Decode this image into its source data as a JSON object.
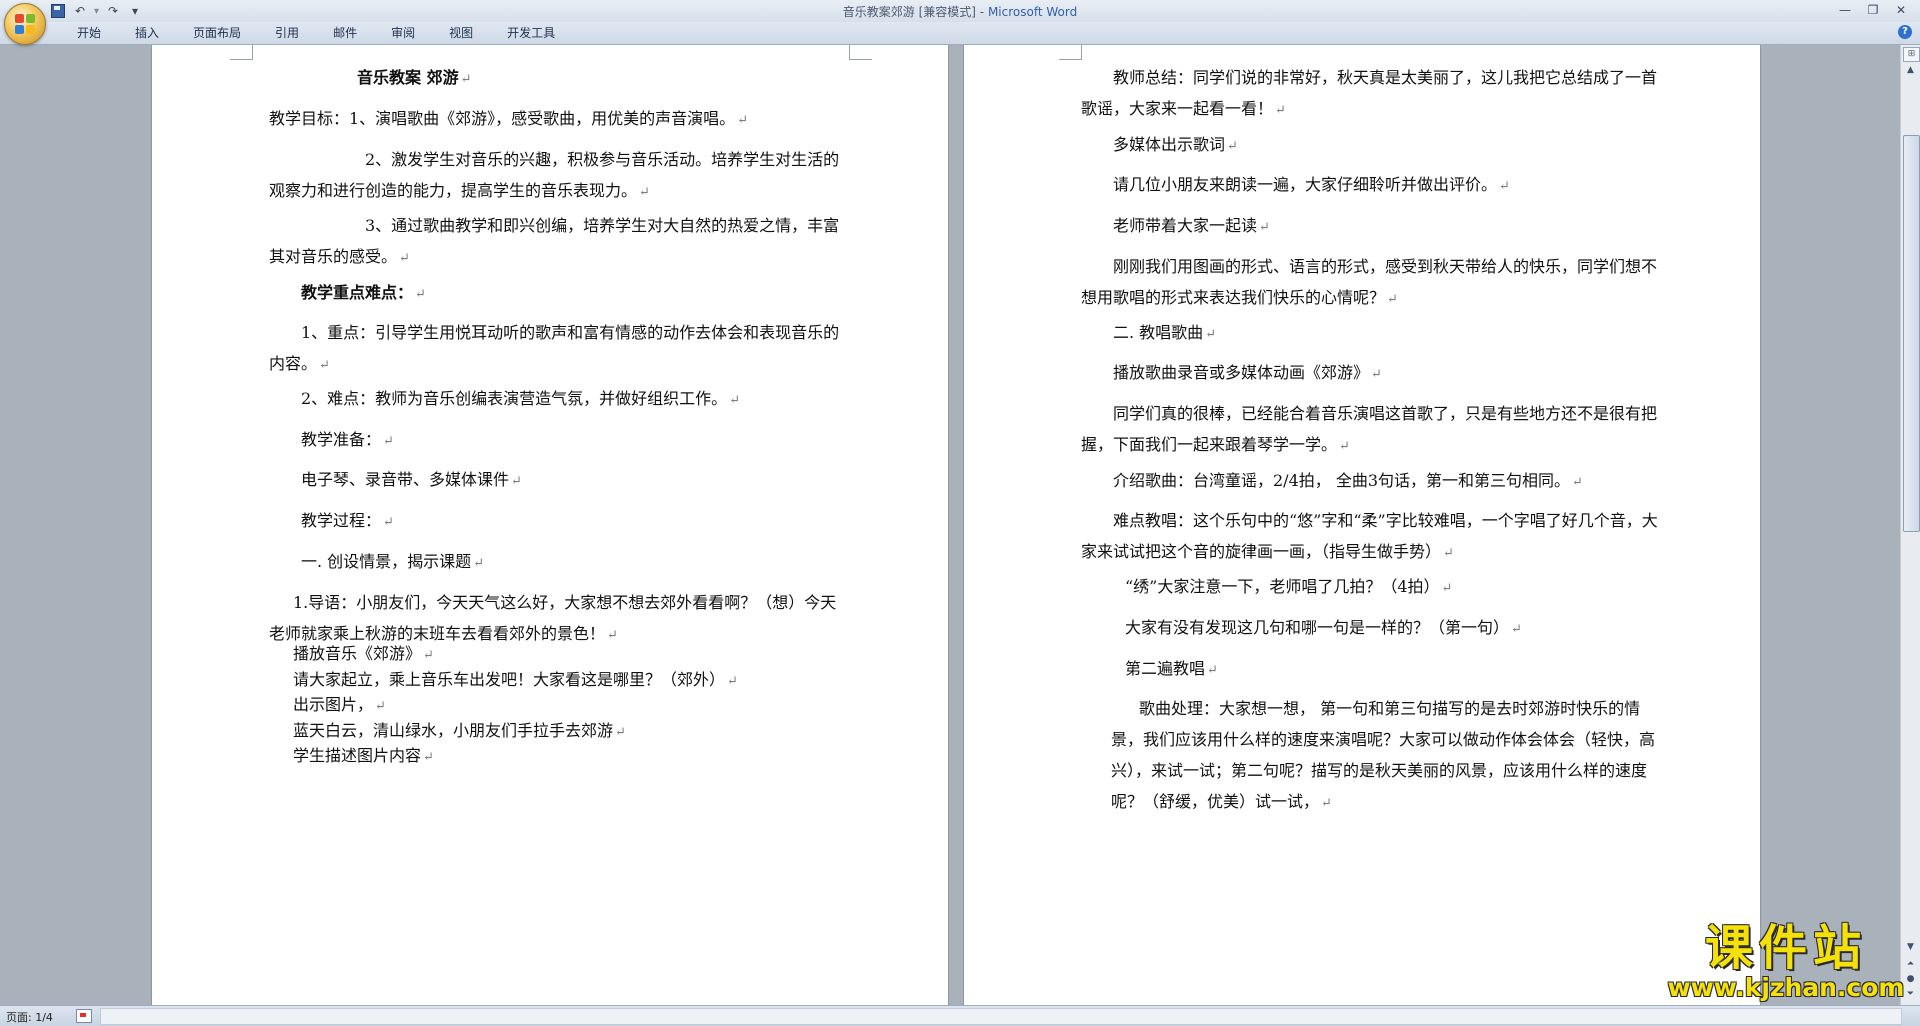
{
  "window": {
    "doc_title": "音乐教案郊游 [兼容模式]",
    "separator": " - ",
    "app_name": "Microsoft Word"
  },
  "quick_access": {
    "more": "▾"
  },
  "ribbon": {
    "tabs": [
      "开始",
      "插入",
      "页面布局",
      "引用",
      "邮件",
      "审阅",
      "视图",
      "开发工具"
    ]
  },
  "pilcrow": "↵",
  "page1": [
    {
      "text": "音乐教案  郊游",
      "bold": true
    },
    {
      "text": "教学目标：1、演唱歌曲《郊游》，感受歌曲，用优美的声音演唱。"
    },
    {
      "text": "2、激发学生对音乐的兴趣，积极参与音乐活动。培养学生对生活的观察力和进行创造的能力，提高学生的音乐表现力。"
    },
    {
      "text": "3、通过歌曲教学和即兴创编，培养学生对大自然的热爱之情，丰富其对音乐的感受。"
    },
    {
      "text": "教学重点难点：",
      "bold": true
    },
    {
      "text": "1、重点：引导学生用悦耳动听的歌声和富有情感的动作去体会和表现音乐的内容。"
    },
    {
      "text": "2、难点：教师为音乐创编表演营造气氛，并做好组织工作。"
    },
    {
      "text": "教学准备："
    },
    {
      "text": "电子琴、录音带、多媒体课件"
    },
    {
      "text": "教学过程："
    },
    {
      "text": "一. 创设情景，揭示课题"
    },
    {
      "text": "1.导语：小朋友们，今天天气这么好，大家想不想去郊外看看啊？（想）今天老师就家乘上秋游的末班车去看看郊外的景色！"
    },
    {
      "text": "播放音乐《郊游》"
    },
    {
      "text": "请大家起立，乘上音乐车出发吧！大家看这是哪里？（郊外）"
    },
    {
      "text": "出示图片，"
    },
    {
      "text": "蓝天白云，清山绿水，小朋友们手拉手去郊游"
    },
    {
      "text": "学生描述图片内容"
    }
  ],
  "page2": [
    {
      "text": "教师总结：同学们说的非常好，秋天真是太美丽了，这儿我把它总结成了一首歌谣，大家来一起看一看！"
    },
    {
      "text": "多媒体出示歌词"
    },
    {
      "text": "请几位小朋友来朗读一遍，大家仔细聆听并做出评价。"
    },
    {
      "text": "老师带着大家一起读"
    },
    {
      "text": "刚刚我们用图画的形式、语言的形式，感受到秋天带给人的快乐，同学们想不想用歌唱的形式来表达我们快乐的心情呢？"
    },
    {
      "text": "二. 教唱歌曲"
    },
    {
      "text": "播放歌曲录音或多媒体动画《郊游》"
    },
    {
      "text": "同学们真的很棒，已经能合着音乐演唱这首歌了，只是有些地方还不是很有把握，下面我们一起来跟着琴学一学。"
    },
    {
      "text": "介绍歌曲：台湾童谣，2/4拍， 全曲3句话，第一和第三句相同。"
    },
    {
      "text": "难点教唱：这个乐句中的“悠”字和“柔”字比较难唱，一个字唱了好几个音，大家来试试把这个音的旋律画一画，（指导生做手势）"
    },
    {
      "text": "“绣”大家注意一下，老师唱了几拍？（4拍）"
    },
    {
      "text": "大家有没有发现这几句和哪一句是一样的？（第一句）"
    },
    {
      "text": "第二遍教唱"
    },
    {
      "text": "歌曲处理：大家想一想， 第一句和第三句描写的是去时郊游时快乐的情景，我们应该用什么样的速度来演唱呢？大家可以做动作体会体会（轻快，高兴），来试一试；第二句呢？描写的是秋天美丽的风景，应该用什么样的速度呢？（舒缓，优美）试一试，"
    }
  ],
  "status": {
    "page": "页面: 1/4"
  },
  "watermark": {
    "cn": "课件站",
    "url": "www.kjzhan.com"
  },
  "colors": {
    "workspace": "#a9b1bb",
    "title_app": "#3060b0",
    "watermark": "#f5e10a"
  }
}
